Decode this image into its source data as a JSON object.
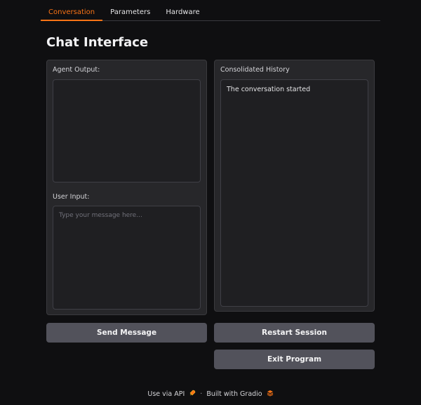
{
  "tabs": [
    {
      "label": "Conversation",
      "active": true
    },
    {
      "label": "Parameters",
      "active": false
    },
    {
      "label": "Hardware",
      "active": false
    }
  ],
  "page_title": "Chat Interface",
  "agent_output": {
    "label": "Agent Output:",
    "value": ""
  },
  "user_input": {
    "label": "User Input:",
    "placeholder": "Type your message here..."
  },
  "history": {
    "label": "Consolidated History",
    "value": "The conversation started"
  },
  "buttons": {
    "send": "Send Message",
    "restart": "Restart Session",
    "exit": "Exit Program"
  },
  "footer": {
    "api": "Use via API",
    "separator": "·",
    "built": "Built with Gradio",
    "api_icon": "rocket-icon",
    "gradio_icon": "gradio-logo-icon"
  },
  "colors": {
    "accent": "#f97316",
    "background": "#0f0f11",
    "panel": "#27272a",
    "button": "#52525b"
  }
}
